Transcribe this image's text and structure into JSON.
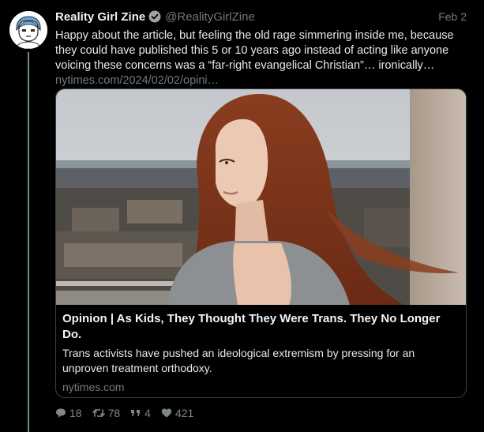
{
  "tweet": {
    "display_name": "Reality Girl Zine",
    "handle": "@RealityGirlZine",
    "date": "Feb 2",
    "text": "Happy about the article, but feeling the old rage simmering inside me, because they could have published this 5 or 10 years ago instead of acting like anyone voicing these concerns was a “far-right evangelical Christian”… ironically…",
    "link_text": "nytimes.com/2024/02/02/opini…"
  },
  "card": {
    "title": "Opinion | As Kids, They Thought They Were Trans. They No Longer Do.",
    "description": "Trans activists have pushed an ideological extremism by pressing for an unproven treatment orthodoxy.",
    "domain": "nytimes.com"
  },
  "actions": {
    "replies": "18",
    "retweets": "78",
    "quotes": "4",
    "likes": "421"
  },
  "icons": {
    "verified": "verified-badge-icon",
    "reply": "comment-icon",
    "retweet": "retweet-icon",
    "quote": "quote-icon",
    "like": "heart-icon"
  },
  "colors": {
    "background": "#000000",
    "thread_line": "#6f8b86",
    "muted_text": "#6f7a80",
    "card_border": "#3a3f42"
  }
}
